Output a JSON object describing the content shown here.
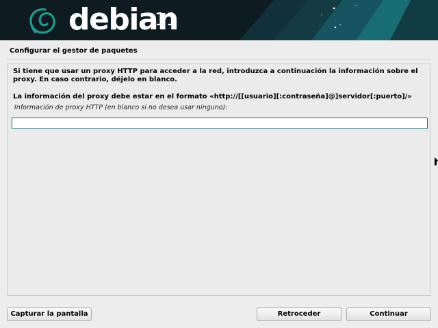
{
  "header": {
    "brand": "debian",
    "version": "11",
    "logo_icon": "debian-swirl-icon",
    "colors": {
      "background": "#0e1c22",
      "swirl": "#1d9d8f",
      "accent": "#16697a"
    }
  },
  "page": {
    "title": "Configurar el gestor de paquetes",
    "description": "Si tiene que usar un proxy HTTP para acceder a la red, introduzca a continuación la información sobre el proxy. En caso contrario, déjelo en blanco.",
    "format_info": "La información del proxy debe estar en el formato «http://[[usuario][:contraseña]@]servidor[:puerto]/»",
    "field_label": "Información de proxy HTTP (en blanco si no desea usar ninguno):",
    "proxy_value": ""
  },
  "buttons": {
    "screenshot": "Capturar la pantalla",
    "back": "Retroceder",
    "continue": "Continuar"
  }
}
